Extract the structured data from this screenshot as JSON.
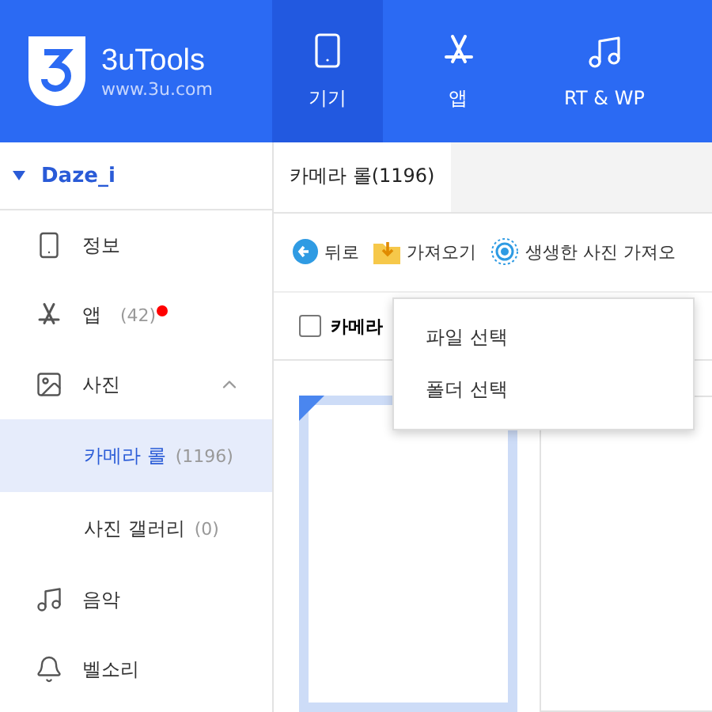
{
  "brand": {
    "name": "3uTools",
    "url": "www.3u.com"
  },
  "nav": [
    {
      "label": "기기",
      "kind": "phone",
      "selected": true
    },
    {
      "label": "앱",
      "kind": "appstore",
      "selected": false
    },
    {
      "label": "RT & WP",
      "kind": "music",
      "selected": false
    }
  ],
  "device": {
    "name": "Daze_i",
    "expanded": true
  },
  "sidebar": {
    "items": [
      {
        "label": "정보",
        "kind": "phone",
        "selected": false
      },
      {
        "label": "앱",
        "count": "(42)",
        "kind": "appstore",
        "badge": true,
        "selected": false
      },
      {
        "label": "사진",
        "kind": "image",
        "expanded": true,
        "selected": false,
        "children": [
          {
            "label": "카메라 롤",
            "count": "(1196)",
            "selected": true
          },
          {
            "label": "사진 갤러리",
            "count": "(0)",
            "selected": false
          }
        ]
      },
      {
        "label": "음악",
        "kind": "music",
        "selected": false
      },
      {
        "label": "벨소리",
        "kind": "bell",
        "selected": false
      }
    ]
  },
  "tabs": [
    {
      "label": "카메라 롤(1196)",
      "selected": true
    }
  ],
  "toolbar": [
    {
      "label": "뒤로",
      "kind": "back"
    },
    {
      "label": "가져오기",
      "kind": "import"
    },
    {
      "label": "생생한 사진 가져오",
      "kind": "live"
    }
  ],
  "select_all": {
    "label": "카메라",
    "checked": false
  },
  "menu": [
    "파일 선택",
    "폴더 선택"
  ],
  "photos": [
    {
      "selected": true
    },
    {
      "selected": false
    }
  ]
}
